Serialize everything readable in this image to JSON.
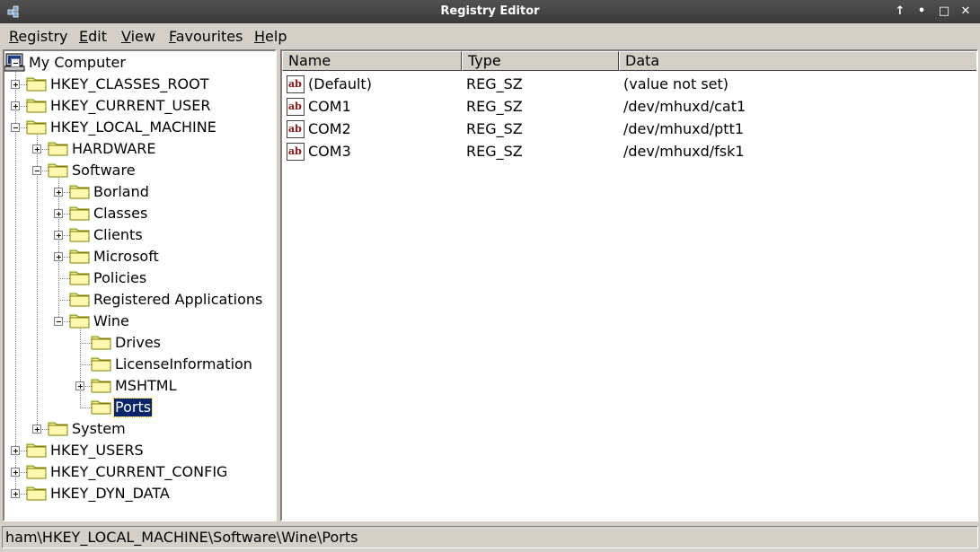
{
  "window": {
    "title": "Registry Editor",
    "buttons": {
      "restore": "↑",
      "minimize": "•",
      "maximize": "□",
      "close": "✕"
    }
  },
  "menu": [
    "Registry",
    "Edit",
    "View",
    "Favourites",
    "Help"
  ],
  "tree": {
    "root": "My Computer",
    "nodes": [
      {
        "label": "HKEY_CLASSES_ROOT",
        "level": 1,
        "toggle": "plus"
      },
      {
        "label": "HKEY_CURRENT_USER",
        "level": 1,
        "toggle": "plus"
      },
      {
        "label": "HKEY_LOCAL_MACHINE",
        "level": 1,
        "toggle": "minus"
      },
      {
        "label": "HARDWARE",
        "level": 2,
        "toggle": "plus"
      },
      {
        "label": "Software",
        "level": 2,
        "toggle": "minus"
      },
      {
        "label": "Borland",
        "level": 3,
        "toggle": "plus"
      },
      {
        "label": "Classes",
        "level": 3,
        "toggle": "plus"
      },
      {
        "label": "Clients",
        "level": 3,
        "toggle": "plus"
      },
      {
        "label": "Microsoft",
        "level": 3,
        "toggle": "plus"
      },
      {
        "label": "Policies",
        "level": 3,
        "toggle": "none"
      },
      {
        "label": "Registered Applications",
        "level": 3,
        "toggle": "none"
      },
      {
        "label": "Wine",
        "level": 3,
        "toggle": "minus"
      },
      {
        "label": "Drives",
        "level": 4,
        "toggle": "none"
      },
      {
        "label": "LicenseInformation",
        "level": 4,
        "toggle": "none"
      },
      {
        "label": "MSHTML",
        "level": 4,
        "toggle": "plus"
      },
      {
        "label": "Ports",
        "level": 4,
        "toggle": "none",
        "selected": true
      },
      {
        "label": "System",
        "level": 2,
        "toggle": "plus"
      },
      {
        "label": "HKEY_USERS",
        "level": 1,
        "toggle": "plus"
      },
      {
        "label": "HKEY_CURRENT_CONFIG",
        "level": 1,
        "toggle": "plus"
      },
      {
        "label": "HKEY_DYN_DATA",
        "level": 1,
        "toggle": "plus"
      }
    ]
  },
  "list": {
    "columns": [
      "Name",
      "Type",
      "Data"
    ],
    "rows": [
      {
        "name": "(Default)",
        "type": "REG_SZ",
        "data": "(value not set)"
      },
      {
        "name": "COM1",
        "type": "REG_SZ",
        "data": "/dev/mhuxd/cat1"
      },
      {
        "name": "COM2",
        "type": "REG_SZ",
        "data": "/dev/mhuxd/ptt1"
      },
      {
        "name": "COM3",
        "type": "REG_SZ",
        "data": "/dev/mhuxd/fsk1"
      }
    ],
    "value_icon_text": "ab"
  },
  "status": "ham\\HKEY_LOCAL_MACHINE\\Software\\Wine\\Ports"
}
